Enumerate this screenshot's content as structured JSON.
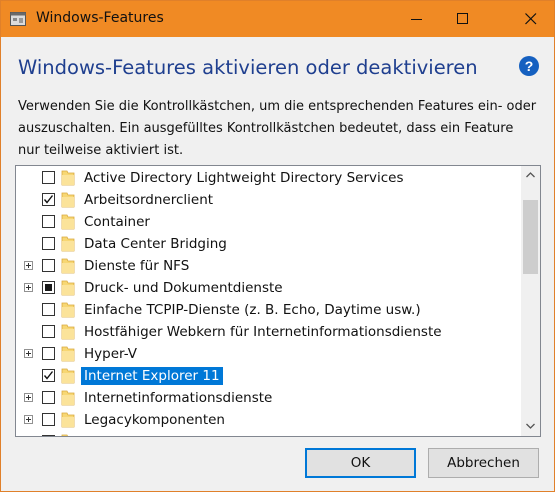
{
  "window": {
    "title": "Windows-Features",
    "accent_color": "#f08a24"
  },
  "header": {
    "heading": "Windows-Features aktivieren oder deaktivieren",
    "heading_color": "#1f3f8f",
    "help_icon": "question-mark-icon"
  },
  "description": "Verwenden Sie die Kontrollkästchen, um die entsprechenden Features ein- oder auszuschalten. Ein ausgefülltes Kontrollkästchen bedeutet, dass ein Feature nur teilweise aktiviert ist.",
  "features": [
    {
      "label": "Active Directory Lightweight Directory Services",
      "state": "unchecked",
      "expandable": false,
      "selected": false
    },
    {
      "label": "Arbeitsordnerclient",
      "state": "checked",
      "expandable": false,
      "selected": false
    },
    {
      "label": "Container",
      "state": "unchecked",
      "expandable": false,
      "selected": false
    },
    {
      "label": "Data Center Bridging",
      "state": "unchecked",
      "expandable": false,
      "selected": false
    },
    {
      "label": "Dienste für NFS",
      "state": "unchecked",
      "expandable": true,
      "selected": false
    },
    {
      "label": "Druck- und Dokumentdienste",
      "state": "partial",
      "expandable": true,
      "selected": false
    },
    {
      "label": "Einfache TCPIP-Dienste (z. B. Echo, Daytime usw.)",
      "state": "unchecked",
      "expandable": false,
      "selected": false
    },
    {
      "label": "Hostfähiger Webkern für Internetinformationsdienste",
      "state": "unchecked",
      "expandable": false,
      "selected": false
    },
    {
      "label": "Hyper-V",
      "state": "unchecked",
      "expandable": true,
      "selected": false
    },
    {
      "label": "Internet Explorer 11",
      "state": "checked",
      "expandable": false,
      "selected": true
    },
    {
      "label": "Internetinformationsdienste",
      "state": "unchecked",
      "expandable": true,
      "selected": false
    },
    {
      "label": "Legacykomponenten",
      "state": "unchecked",
      "expandable": true,
      "selected": false
    },
    {
      "label": "",
      "state": "unchecked",
      "expandable": false,
      "selected": false
    }
  ],
  "buttons": {
    "ok": "OK",
    "cancel": "Abbrechen"
  }
}
